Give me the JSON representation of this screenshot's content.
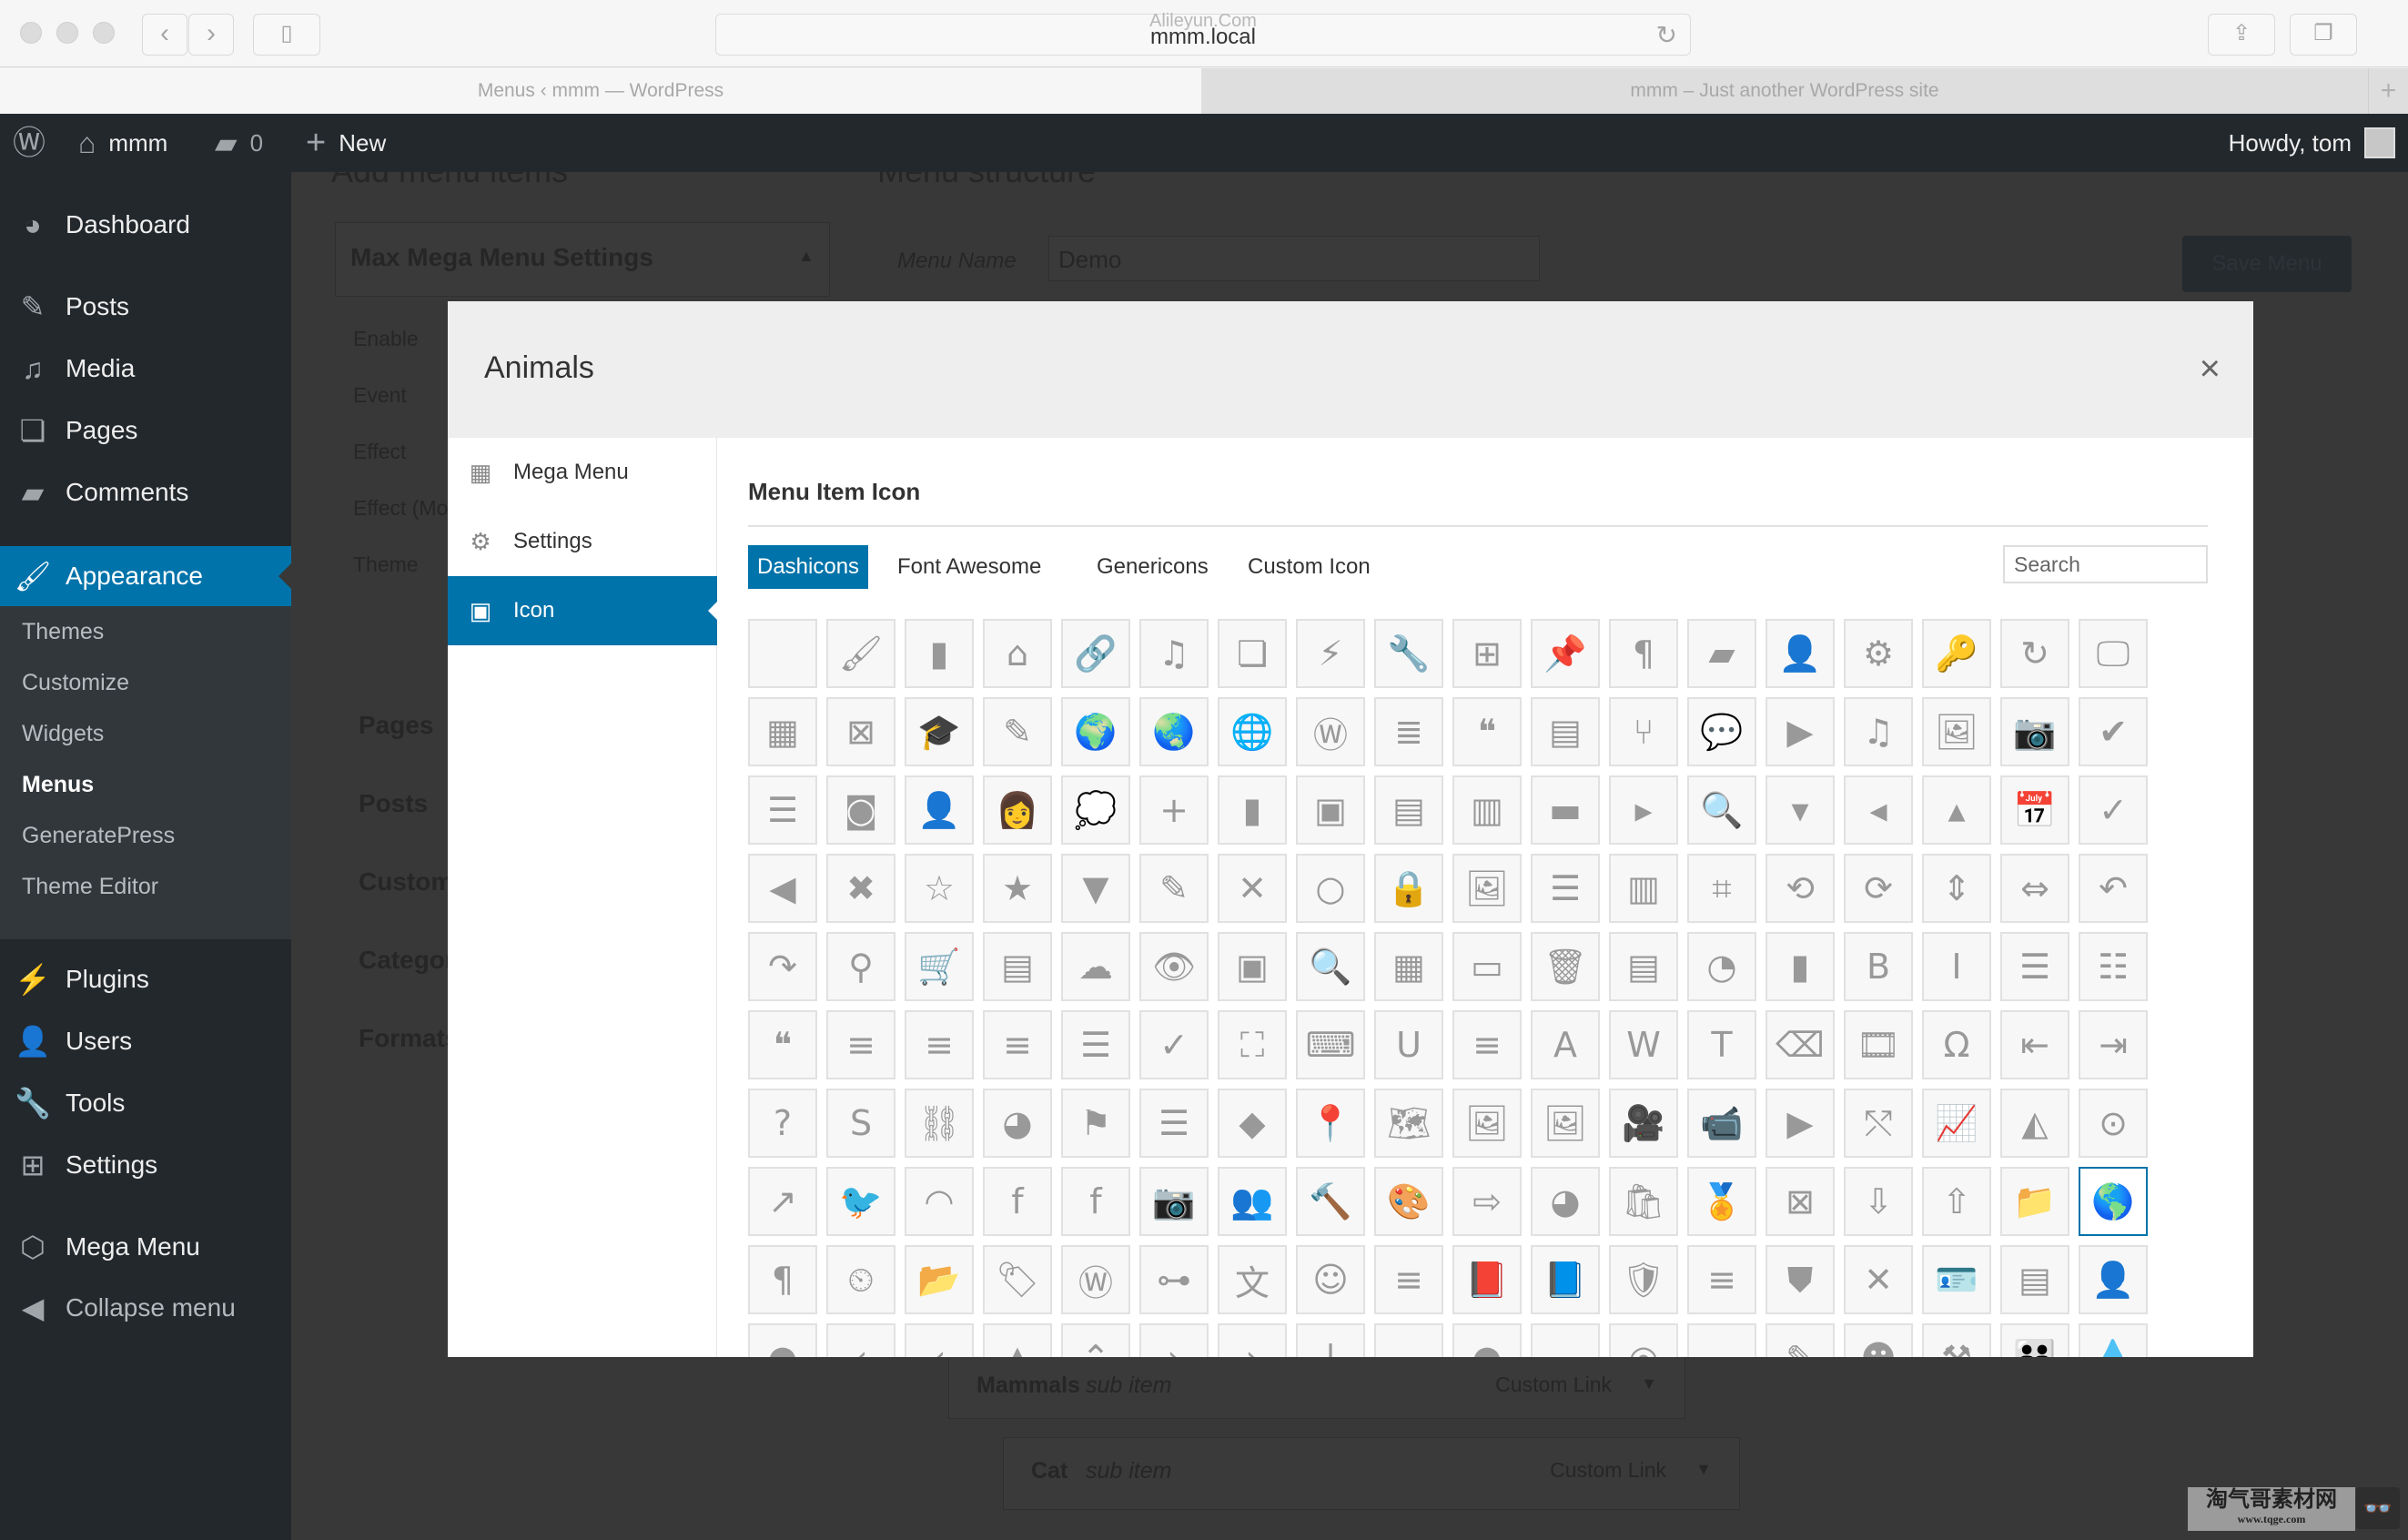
{
  "browser": {
    "url": "mmm.local",
    "url_overlay_watermark": "Alileyun.Com",
    "tabs": [
      {
        "label": "Menus ‹ mmm — WordPress",
        "active": true
      },
      {
        "label": "mmm – Just another WordPress site",
        "active": false
      }
    ]
  },
  "adminbar": {
    "site_name": "mmm",
    "comments_count": "0",
    "new_label": "New",
    "greeting": "Howdy, tom"
  },
  "sidebar": {
    "items": [
      {
        "label": "Dashboard",
        "icon": "dashboard-icon"
      },
      {
        "label": "Posts",
        "icon": "pin-icon"
      },
      {
        "label": "Media",
        "icon": "media-icon"
      },
      {
        "label": "Pages",
        "icon": "pages-icon"
      },
      {
        "label": "Comments",
        "icon": "comment-icon"
      },
      {
        "label": "Appearance",
        "icon": "paintbrush-icon",
        "current": true
      },
      {
        "label": "Plugins",
        "icon": "plug-icon"
      },
      {
        "label": "Users",
        "icon": "user-icon"
      },
      {
        "label": "Tools",
        "icon": "wrench-icon"
      },
      {
        "label": "Settings",
        "icon": "sliders-icon"
      },
      {
        "label": "Mega Menu",
        "icon": "cube-icon"
      },
      {
        "label": "Collapse menu",
        "icon": "collapse-icon"
      }
    ],
    "submenu": [
      {
        "label": "Themes"
      },
      {
        "label": "Customize"
      },
      {
        "label": "Widgets"
      },
      {
        "label": "Menus",
        "current": true
      },
      {
        "label": "GeneratePress"
      },
      {
        "label": "Theme Editor"
      }
    ]
  },
  "background_page": {
    "add_menu_items_heading": "Add menu items",
    "menu_structure_heading": "Menu structure",
    "mega_menu_settings_title": "Max Mega Menu Settings",
    "settings_labels": [
      "Enable",
      "Event",
      "Effect",
      "Effect (Mobile)",
      "Theme"
    ],
    "accordion_sections": [
      "Pages",
      "Posts",
      "Custom Links",
      "Categories",
      "Formats"
    ],
    "menu_name_label": "Menu Name",
    "menu_name_value": "Demo",
    "save_button": "Save Menu",
    "menu_items": [
      {
        "title": "Mammals",
        "subtitle": "sub item",
        "type": "Custom Link"
      },
      {
        "title": "Cat",
        "subtitle": "sub item",
        "type": "Custom Link"
      }
    ]
  },
  "modal": {
    "title": "Animals",
    "close_label": "×",
    "nav": [
      {
        "label": "Mega Menu",
        "icon": "mega-menu-icon"
      },
      {
        "label": "Settings",
        "icon": "gear-icon"
      },
      {
        "label": "Icon",
        "icon": "image-icon",
        "active": true
      }
    ],
    "section_title": "Menu Item Icon",
    "icon_tabs": [
      {
        "label": "Dashicons",
        "active": true
      },
      {
        "label": "Font Awesome"
      },
      {
        "label": "Genericons"
      },
      {
        "label": "Custom Icon"
      }
    ],
    "search_placeholder": "Search",
    "selected_icon": "earth-icon",
    "icons": [
      {
        "name": "none-icon",
        "glyph": ""
      },
      {
        "name": "paintbrush-icon",
        "glyph": "🖌"
      },
      {
        "name": "comment-icon",
        "glyph": "▮"
      },
      {
        "name": "home-icon",
        "glyph": "⌂"
      },
      {
        "name": "link-icon",
        "glyph": "🔗"
      },
      {
        "name": "media-icon",
        "glyph": "♫"
      },
      {
        "name": "pages-icon",
        "glyph": "❏"
      },
      {
        "name": "plugin-icon",
        "glyph": "⚡"
      },
      {
        "name": "wrench-icon",
        "glyph": "🔧"
      },
      {
        "name": "sliders-icon",
        "glyph": "⊞"
      },
      {
        "name": "pin-icon",
        "glyph": "📌"
      },
      {
        "name": "paragraph-rtl-icon",
        "glyph": "¶"
      },
      {
        "name": "marker-icon",
        "glyph": "▰"
      },
      {
        "name": "user-icon",
        "glyph": "👤"
      },
      {
        "name": "gear-icon",
        "glyph": "⚙"
      },
      {
        "name": "key-icon",
        "glyph": "🔑"
      },
      {
        "name": "update-icon",
        "glyph": "↻"
      },
      {
        "name": "visibility-monitor-icon",
        "glyph": "🖵"
      },
      {
        "name": "layout-icon",
        "glyph": "▦"
      },
      {
        "name": "no-comment-icon",
        "glyph": "⊠"
      },
      {
        "name": "education-icon",
        "glyph": "🎓"
      },
      {
        "name": "edit-page-icon",
        "glyph": "✎"
      },
      {
        "name": "globe-africa-icon",
        "glyph": "🌍"
      },
      {
        "name": "globe-asia-icon",
        "glyph": "🌏"
      },
      {
        "name": "translation-globe-icon",
        "glyph": "🌐"
      },
      {
        "name": "wordpress-icon",
        "glyph": "Ⓦ"
      },
      {
        "name": "text-page-icon",
        "glyph": "≣"
      },
      {
        "name": "quote-icon",
        "glyph": "❝"
      },
      {
        "name": "note-icon",
        "glyph": "▤"
      },
      {
        "name": "git-branch-icon",
        "glyph": "⑂"
      },
      {
        "name": "chat-bubbles-icon",
        "glyph": "💬"
      },
      {
        "name": "video-icon",
        "glyph": "▶"
      },
      {
        "name": "music-icon",
        "glyph": "♫"
      },
      {
        "name": "image-icon",
        "glyph": "🖼"
      },
      {
        "name": "camera-icon",
        "glyph": "📷"
      },
      {
        "name": "check-circle-icon",
        "glyph": "✔"
      },
      {
        "name": "ordered-list-rtl-icon",
        "glyph": "☰"
      },
      {
        "name": "instagram-icon",
        "glyph": "◙"
      },
      {
        "name": "businessman-icon",
        "glyph": "👤"
      },
      {
        "name": "businesswoman-icon",
        "glyph": "👩"
      },
      {
        "name": "thought-bubble-icon",
        "glyph": "💭"
      },
      {
        "name": "plus-icon",
        "glyph": "+"
      },
      {
        "name": "new-page-icon",
        "glyph": "▮"
      },
      {
        "name": "align-center-icon",
        "glyph": "▣"
      },
      {
        "name": "align-left-icon",
        "glyph": "▤"
      },
      {
        "name": "align-right-icon",
        "glyph": "▥"
      },
      {
        "name": "align-none-icon",
        "glyph": "▬"
      },
      {
        "name": "arrow-right-icon",
        "glyph": "▸"
      },
      {
        "name": "code-search-icon",
        "glyph": "🔍"
      },
      {
        "name": "arrow-down-icon",
        "glyph": "▾"
      },
      {
        "name": "arrow-left-icon",
        "glyph": "◂"
      },
      {
        "name": "arrow-up-icon",
        "glyph": "▴"
      },
      {
        "name": "calendar-icon",
        "glyph": "📅"
      },
      {
        "name": "checkmark-icon",
        "glyph": "✓"
      },
      {
        "name": "back-circle-icon",
        "glyph": "◀"
      },
      {
        "name": "dismiss-icon",
        "glyph": "✖"
      },
      {
        "name": "star-empty-icon",
        "glyph": "☆"
      },
      {
        "name": "star-filled-icon",
        "glyph": "★"
      },
      {
        "name": "sort-icon",
        "glyph": "▼"
      },
      {
        "name": "edit-pin-icon",
        "glyph": "✎"
      },
      {
        "name": "no-alt-icon",
        "glyph": "✕"
      },
      {
        "name": "marker-circle-icon",
        "glyph": "○"
      },
      {
        "name": "lock-icon",
        "glyph": "🔒"
      },
      {
        "name": "images-icon",
        "glyph": "🖼"
      },
      {
        "name": "list-view-icon",
        "glyph": "☰"
      },
      {
        "name": "excerpt-view-icon",
        "glyph": "▥"
      },
      {
        "name": "crop-icon",
        "glyph": "⌗"
      },
      {
        "name": "rotate-left-icon",
        "glyph": "⟲"
      },
      {
        "name": "rotate-right-icon",
        "glyph": "⟳"
      },
      {
        "name": "flip-vertical-icon",
        "glyph": "⇕"
      },
      {
        "name": "flip-horizontal-icon",
        "glyph": "⇔"
      },
      {
        "name": "undo-icon",
        "glyph": "↶"
      },
      {
        "name": "redo-icon",
        "glyph": "↷"
      },
      {
        "name": "pin-needle-icon",
        "glyph": "⚲"
      },
      {
        "name": "cart-icon",
        "glyph": "🛒"
      },
      {
        "name": "feedback-icon",
        "glyph": "▤"
      },
      {
        "name": "cloud-icon",
        "glyph": "☁"
      },
      {
        "name": "visibility-icon",
        "glyph": "👁"
      },
      {
        "name": "vault-icon",
        "glyph": "▣"
      },
      {
        "name": "search-icon",
        "glyph": "🔍"
      },
      {
        "name": "screen-options-icon",
        "glyph": "▦"
      },
      {
        "name": "slides-icon",
        "glyph": "▭"
      },
      {
        "name": "trash-icon",
        "glyph": "🗑"
      },
      {
        "name": "analytics-icon",
        "glyph": "▤"
      },
      {
        "name": "chart-pie-icon",
        "glyph": "◔"
      },
      {
        "name": "chart-bar-icon",
        "glyph": "▮"
      },
      {
        "name": "bold-icon",
        "glyph": "B"
      },
      {
        "name": "italic-icon",
        "glyph": "I"
      },
      {
        "name": "unordered-list-icon",
        "glyph": "☰"
      },
      {
        "name": "ordered-list-icon",
        "glyph": "☷"
      },
      {
        "name": "blockquote-icon",
        "glyph": "❝"
      },
      {
        "name": "text-align-left-icon",
        "glyph": "≡"
      },
      {
        "name": "text-align-center-icon",
        "glyph": "≡"
      },
      {
        "name": "text-align-right-icon",
        "glyph": "≡"
      },
      {
        "name": "insert-more-icon",
        "glyph": "☰"
      },
      {
        "name": "spellcheck-icon",
        "glyph": "✓"
      },
      {
        "name": "fullscreen-icon",
        "glyph": "⛶"
      },
      {
        "name": "kitchen-sink-icon",
        "glyph": "⌨"
      },
      {
        "name": "underline-icon",
        "glyph": "U"
      },
      {
        "name": "justify-icon",
        "glyph": "≡"
      },
      {
        "name": "text-color-icon",
        "glyph": "A"
      },
      {
        "name": "paste-word-icon",
        "glyph": "W"
      },
      {
        "name": "paste-text-icon",
        "glyph": "T"
      },
      {
        "name": "remove-formatting-icon",
        "glyph": "⌫"
      },
      {
        "name": "video-film-icon",
        "glyph": "🎞"
      },
      {
        "name": "custom-character-icon",
        "glyph": "Ω"
      },
      {
        "name": "outdent-icon",
        "glyph": "⇤"
      },
      {
        "name": "indent-icon",
        "glyph": "⇥"
      },
      {
        "name": "help-icon",
        "glyph": "?"
      },
      {
        "name": "strikethrough-icon",
        "glyph": "S"
      },
      {
        "name": "unlink-icon",
        "glyph": "⛓"
      },
      {
        "name": "dashboard-icon",
        "glyph": "◕"
      },
      {
        "name": "flag-icon",
        "glyph": "⚑"
      },
      {
        "name": "menu-icon",
        "glyph": "☰"
      },
      {
        "name": "leftright-icon",
        "glyph": "◆"
      },
      {
        "name": "location-icon",
        "glyph": "📍"
      },
      {
        "name": "location-alt-icon",
        "glyph": "🗺"
      },
      {
        "name": "images-alt-icon",
        "glyph": "🖼"
      },
      {
        "name": "images-alt2-icon",
        "glyph": "🖼"
      },
      {
        "name": "video-alt-icon",
        "glyph": "🎥"
      },
      {
        "name": "video-alt2-icon",
        "glyph": "📹"
      },
      {
        "name": "video-alt3-icon",
        "glyph": "▶"
      },
      {
        "name": "share-icon",
        "glyph": "⤲"
      },
      {
        "name": "chart-line-icon",
        "glyph": "📈"
      },
      {
        "name": "chart-area-icon",
        "glyph": "◭"
      },
      {
        "name": "share-alt-icon",
        "glyph": "⊙"
      },
      {
        "name": "share-alt2-icon",
        "glyph": "↗"
      },
      {
        "name": "twitter-icon",
        "glyph": "🐦"
      },
      {
        "name": "rss-icon",
        "glyph": "◠"
      },
      {
        "name": "facebook-icon",
        "glyph": "f"
      },
      {
        "name": "facebook-alt-icon",
        "glyph": "f"
      },
      {
        "name": "camera-alt-icon",
        "glyph": "📷"
      },
      {
        "name": "groups-icon",
        "glyph": "👥"
      },
      {
        "name": "hammer-icon",
        "glyph": "🔨"
      },
      {
        "name": "art-icon",
        "glyph": "🎨"
      },
      {
        "name": "migrate-icon",
        "glyph": "⇨"
      },
      {
        "name": "performance-icon",
        "glyph": "◕"
      },
      {
        "name": "products-icon",
        "glyph": "🛍"
      },
      {
        "name": "awards-icon",
        "glyph": "🏅"
      },
      {
        "name": "forms-icon",
        "glyph": "⊠"
      },
      {
        "name": "download-icon",
        "glyph": "⇩"
      },
      {
        "name": "upload-icon",
        "glyph": "⇧"
      },
      {
        "name": "category-icon",
        "glyph": "📁"
      },
      {
        "name": "earth-icon",
        "glyph": "🌎"
      },
      {
        "name": "paragraph-ltr-icon",
        "glyph": "¶"
      },
      {
        "name": "backup-icon",
        "glyph": "⏲"
      },
      {
        "name": "portfolio-icon",
        "glyph": "📂"
      },
      {
        "name": "tag-icon",
        "glyph": "🏷"
      },
      {
        "name": "wordpress-alt-icon",
        "glyph": "Ⓦ"
      },
      {
        "name": "networking-icon",
        "glyph": "⊶"
      },
      {
        "name": "translation-icon",
        "glyph": "文"
      },
      {
        "name": "smiley-icon",
        "glyph": "☺"
      },
      {
        "name": "editor-ul-small-icon",
        "glyph": "≡"
      },
      {
        "name": "book-icon",
        "glyph": "📕"
      },
      {
        "name": "book-alt-icon",
        "glyph": "📘"
      },
      {
        "name": "shield-icon",
        "glyph": "🛡"
      },
      {
        "name": "menu-alt-icon",
        "glyph": "≡"
      },
      {
        "name": "shield-alt-icon",
        "glyph": "⛊"
      },
      {
        "name": "no-icon",
        "glyph": "✕"
      },
      {
        "name": "id-icon",
        "glyph": "🪪"
      },
      {
        "name": "id-alt-icon",
        "glyph": "▤"
      },
      {
        "name": "businessperson-icon",
        "glyph": "👤"
      },
      {
        "name": "lightbulb-icon",
        "glyph": "●"
      },
      {
        "name": "arrow-left-alt-icon",
        "glyph": "‹"
      },
      {
        "name": "arrow-left-alt2-icon",
        "glyph": "‹"
      },
      {
        "name": "sort-up-icon",
        "glyph": "▲"
      },
      {
        "name": "caret-up-icon",
        "glyph": "⌃"
      },
      {
        "name": "arrow-right-alt-icon",
        "glyph": "›"
      },
      {
        "name": "arrow-right-alt2-icon",
        "glyph": "›"
      },
      {
        "name": "vertical-line-icon",
        "glyph": "|"
      },
      {
        "name": "smile-alt-icon",
        "glyph": "⌣"
      },
      {
        "name": "bulb-icon",
        "glyph": "●"
      },
      {
        "name": "minus-icon",
        "glyph": "−"
      },
      {
        "name": "sos-icon",
        "glyph": "◎"
      },
      {
        "name": "cloud-small-icon",
        "glyph": "☁"
      },
      {
        "name": "edit-large-icon",
        "glyph": "✎"
      },
      {
        "name": "pets-icon",
        "glyph": "☻"
      },
      {
        "name": "hammer-alt-icon",
        "glyph": "⚒"
      },
      {
        "name": "people-icon",
        "glyph": "👪"
      },
      {
        "name": "drops-icon",
        "glyph": "💧"
      }
    ]
  }
}
